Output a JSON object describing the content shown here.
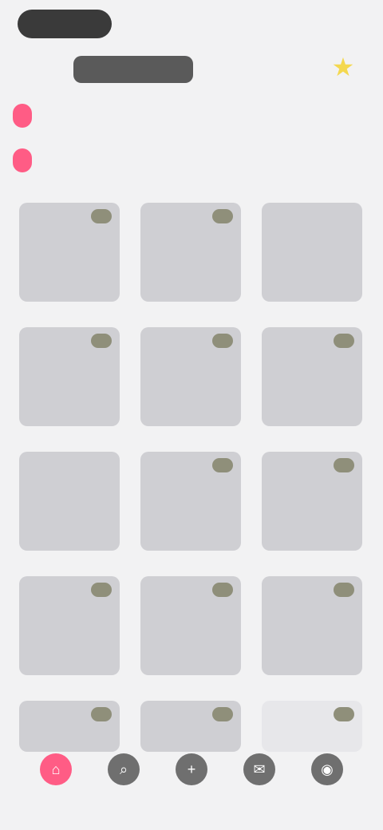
{
  "top": {
    "pill": ""
  },
  "header": {
    "title": ""
  },
  "tabs": {
    "row1": [
      "",
      "",
      "",
      "",
      ""
    ],
    "row2": [
      "",
      "",
      "",
      "",
      ""
    ]
  },
  "cards": [
    {
      "title": ""
    },
    {
      "title": ""
    },
    {
      "title": ""
    },
    {
      "title": ""
    },
    {
      "title": ""
    },
    {
      "title": ""
    },
    {
      "title": ""
    },
    {
      "title": ""
    },
    {
      "title": ""
    },
    {
      "title": ""
    },
    {
      "title": ""
    },
    {
      "title": ""
    },
    {
      "title": ""
    },
    {
      "title": ""
    },
    {
      "title": ""
    }
  ],
  "bottom_nav": [
    "",
    "",
    "",
    "",
    ""
  ],
  "icons": {
    "favorite": "star-icon",
    "nav": [
      "home-icon",
      "search-icon",
      "add-icon",
      "message-icon",
      "profile-icon"
    ]
  },
  "colors": {
    "accent": "#ff5c85",
    "star": "#f4d84f",
    "card": "#cfcfd3",
    "badge": "#8f8f7a",
    "dark_pill": "#3a3a3a"
  }
}
